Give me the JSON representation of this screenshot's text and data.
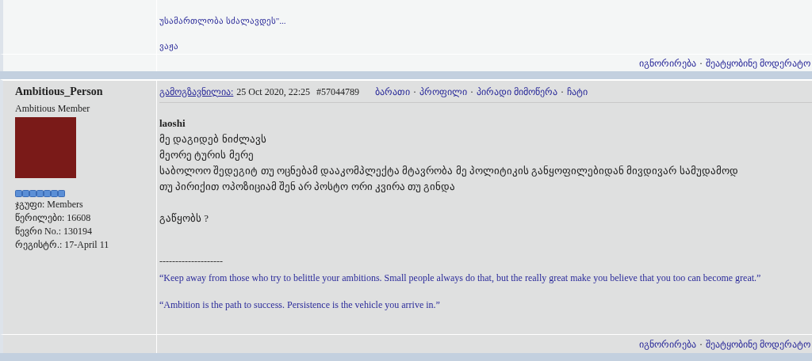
{
  "previous_post": {
    "paragraphs": [
      [
        "უსამართლობა სძალავდეს\"..."
      ],
      [
        "ვაჟა"
      ]
    ],
    "footer_links": [
      "იგნორირება",
      "შეატყობინე მოდერატო"
    ],
    "separator": "·"
  },
  "post": {
    "author": {
      "name": "Ambitious_Person",
      "rank": "Ambitious Member",
      "stats": [
        "ჯგუფი: Members",
        "წერილები: 16608",
        "წევრი No.: 130194",
        "რეგისტრ.: 17-April 11"
      ]
    },
    "header": {
      "sent_label": "გამოგზავნილია:",
      "date": "25 Oct 2020, 22:25",
      "post_number": "#57044789",
      "links": [
        "ბარათი",
        "პროფილი",
        "პირადი მიმოწერა",
        "ჩატი"
      ],
      "separator": "·"
    },
    "quote_author": "laoshi",
    "paragraphs": [
      [
        "მე დაგიდებ ნიძლავს",
        "მეორე ტურის მერე",
        "საბოლოო შედეგიტ თუ ოცნებამ დააკომპლექტა მტავრობა მე პოლიტიკის განყოფილებიდან მივდივარ სამუდამოდ",
        "თუ პირიქით ოპოზიციამ შენ არ პოსტო ორი კვირა თუ გინდა"
      ],
      [
        "გაწყობს ?"
      ]
    ],
    "signature": {
      "divider": "--------------------",
      "quotes": [
        "“Keep away from those who try to belittle your ambitions. Small people always do that, but the really great make you believe that you too can become great.”",
        "“Ambition is the path to success. Persistence is the vehicle you arrive in.”"
      ]
    },
    "footer_links": [
      "იგნორირება",
      "შეატყობინე მოდერატო"
    ],
    "separator": "·"
  }
}
